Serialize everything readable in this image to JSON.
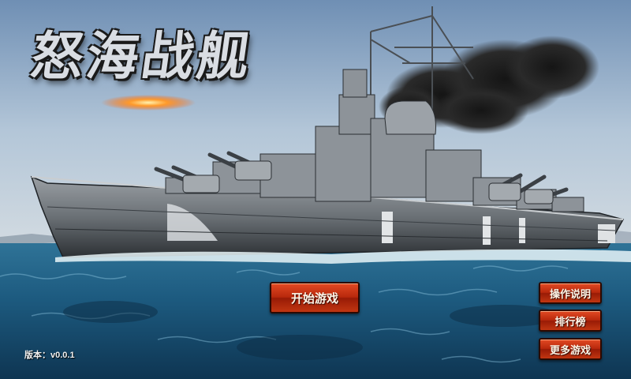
{
  "game": {
    "title": "怒海战舰",
    "version_text": "版本：v0.0.1"
  },
  "menu": {
    "start_label": "开始游戏",
    "instructions_label": "操作说明",
    "leaderboard_label": "排行榜",
    "more_games_label": "更多游戏"
  },
  "colors": {
    "button_red": "#c13611",
    "sea": "#1c5a7d",
    "sky": "#9fb7cf"
  }
}
